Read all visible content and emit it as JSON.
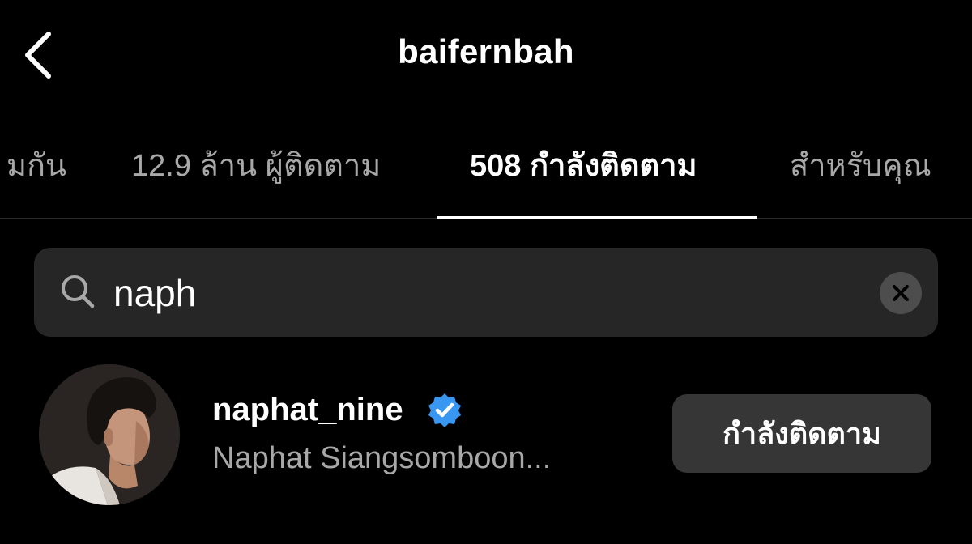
{
  "header": {
    "title": "baifernbah",
    "back_icon": "chevron-left-icon"
  },
  "tabs": [
    {
      "label": "มกัน",
      "active": false
    },
    {
      "label": "12.9 ล้าน ผู้ติดตาม",
      "active": false
    },
    {
      "label": "508 กำลังติดตาม",
      "active": true
    },
    {
      "label": "สำหรับคุณ",
      "active": false
    }
  ],
  "search": {
    "value": "naph",
    "icon": "search-icon",
    "clear_icon": "close-icon"
  },
  "results": [
    {
      "username": "naphat_nine",
      "verified": true,
      "full_name": "Naphat Siangsomboon...",
      "button_label": "กำลังติดตาม"
    }
  ],
  "colors": {
    "background": "#000000",
    "primary_text": "#ffffff",
    "secondary_text": "#a8a8a8",
    "search_bg": "#262626",
    "button_bg": "#363636",
    "verified_blue": "#3897f0"
  }
}
